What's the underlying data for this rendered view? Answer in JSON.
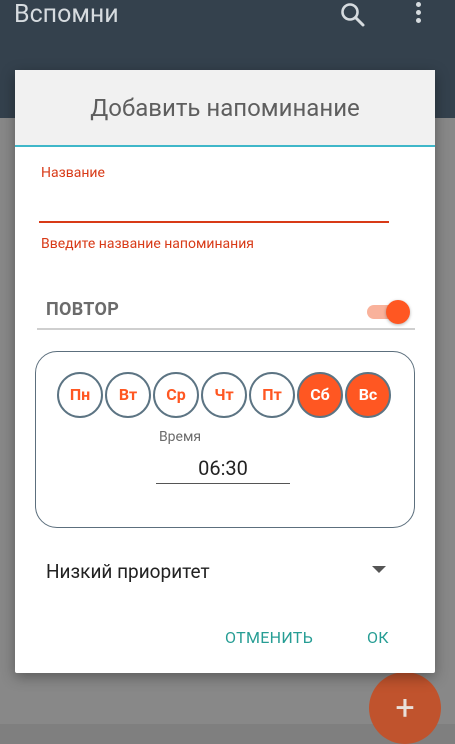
{
  "appbar": {
    "title": "Вспомни"
  },
  "dialog": {
    "title": "Добавить напоминание",
    "name_field": {
      "label": "Название",
      "value": "",
      "error": "Введите название напоминания"
    },
    "repeat": {
      "label": "ПОВТОР",
      "enabled": true
    },
    "days": [
      {
        "label": "Пн",
        "selected": false
      },
      {
        "label": "Вт",
        "selected": false
      },
      {
        "label": "Ср",
        "selected": false
      },
      {
        "label": "Чт",
        "selected": false
      },
      {
        "label": "Пт",
        "selected": false
      },
      {
        "label": "Сб",
        "selected": true
      },
      {
        "label": "Вс",
        "selected": true
      }
    ],
    "time": {
      "label": "Время",
      "value": "06:30"
    },
    "priority": {
      "value": "Низкий приоритет"
    },
    "buttons": {
      "cancel": "ОТМЕНИТЬ",
      "ok": "ОК"
    }
  },
  "fab": {
    "label": "+"
  },
  "colors": {
    "accent": "#ff5722",
    "error": "#d83a17",
    "teal": "#269d94",
    "header_underline": "#3fb7c9"
  }
}
